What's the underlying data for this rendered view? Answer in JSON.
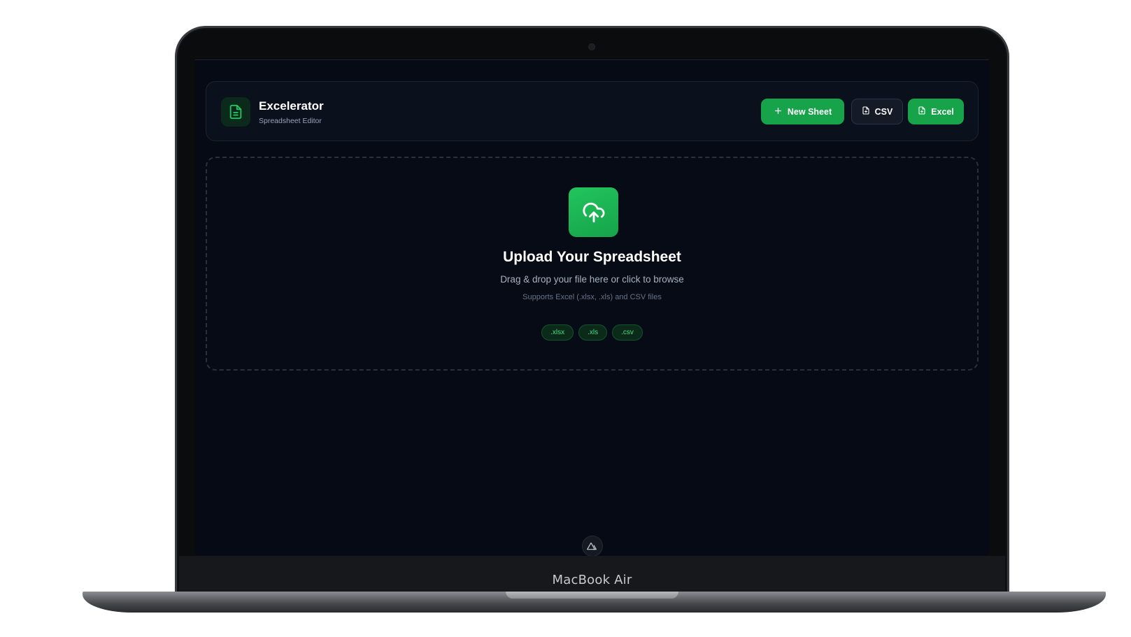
{
  "device": {
    "model_label": "MacBook Air"
  },
  "header": {
    "title": "Excelerator",
    "subtitle": "Spreadsheet Editor",
    "logo_icon": "file-text-icon",
    "buttons": {
      "new_sheet": "New Sheet",
      "csv": "CSV",
      "excel": "Excel"
    }
  },
  "dropzone": {
    "icon": "cloud-upload-icon",
    "title": "Upload Your Spreadsheet",
    "subtitle": "Drag & drop your file here or click to browse",
    "hint": "Supports Excel (.xlsx, .xls) and CSV files",
    "formats": [
      ".xlsx",
      ".xls",
      ".csv"
    ]
  },
  "colors": {
    "accent": "#16a34a",
    "background": "#050a14",
    "chip_text": "#4ade80"
  }
}
